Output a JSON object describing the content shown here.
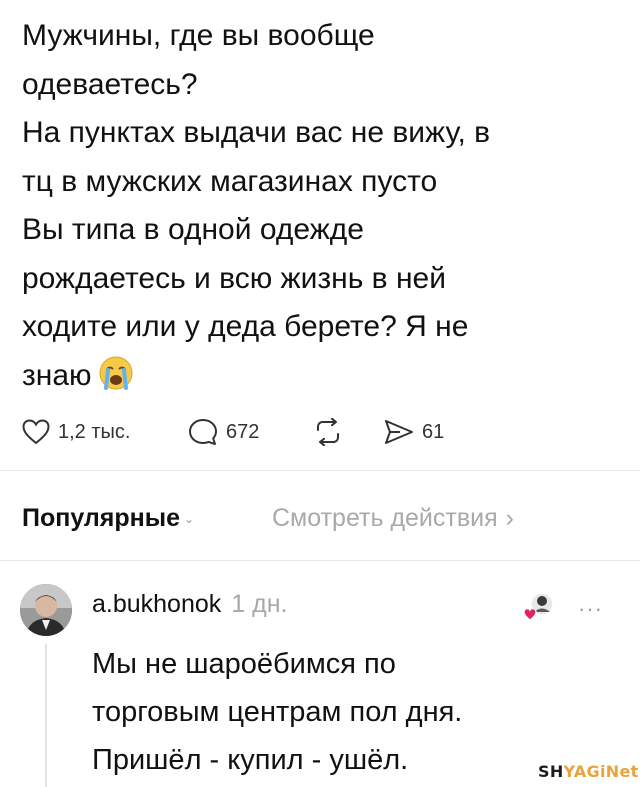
{
  "post": {
    "lines": [
      "Мужчины, где вы вообще",
      "одеваетесь?",
      "На пунктах выдачи вас не вижу, в",
      "тц в мужских магазинах пусто",
      "Вы типа в одной одежде",
      "рождаетесь и всю жизнь в ней",
      "ходите или у деда берете? Я не",
      "знаю"
    ],
    "emoji": "loudly-crying-face-emoji"
  },
  "actions": {
    "likes": "1,2 тыс.",
    "comments": "672",
    "reposts_icon": "repost-icon",
    "shares": "61"
  },
  "tabs": {
    "popular": "Популярные",
    "view_activity": "Смотреть действия"
  },
  "comment": {
    "username": "a.bukhonok",
    "time": "1 дн.",
    "more": "···",
    "lines": [
      "Мы не шароёбимся по",
      "торговым центрам пол дня.",
      "Пришёл - купил - ушёл."
    ]
  },
  "watermark": {
    "part1": "SH",
    "part2": "YAGiNet"
  },
  "colors": {
    "text": "#111111",
    "muted": "#a8a8a8",
    "divider": "#e6e6e6",
    "like_heart": "#e0245e"
  }
}
